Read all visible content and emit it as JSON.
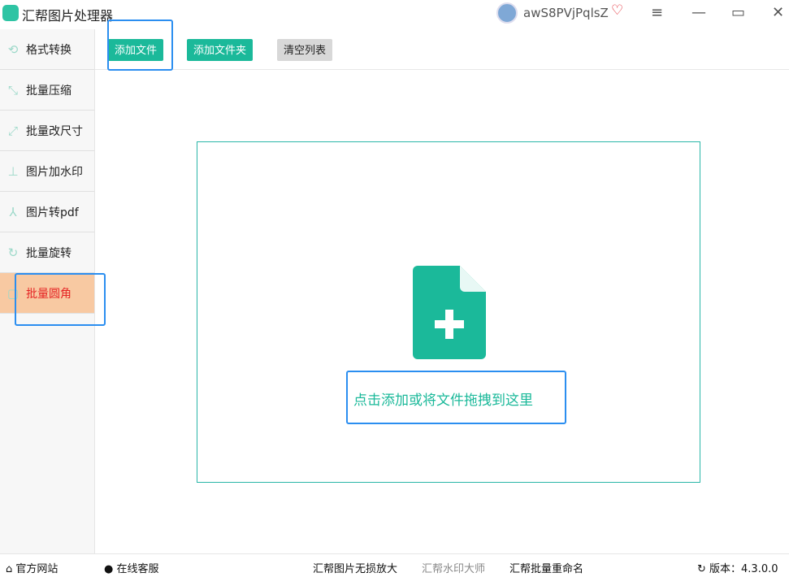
{
  "app": {
    "title": "汇帮图片处理器",
    "username": "awS8PVjPqlsZ"
  },
  "window": {
    "menu": "≡",
    "minimize": "—",
    "maximize": "▭",
    "close": "✕"
  },
  "sidebar": {
    "items": [
      {
        "label": "格式转换",
        "icon": "refresh-convert-icon"
      },
      {
        "label": "批量压缩",
        "icon": "compress-icon"
      },
      {
        "label": "批量改尺寸",
        "icon": "resize-icon"
      },
      {
        "label": "图片加水印",
        "icon": "stamp-icon"
      },
      {
        "label": "图片转pdf",
        "icon": "pdf-icon"
      },
      {
        "label": "批量旋转",
        "icon": "rotate-icon"
      },
      {
        "label": "批量圆角",
        "icon": "rounded-corner-icon",
        "active": true
      }
    ]
  },
  "toolbar": {
    "add_file": "添加文件",
    "add_folder": "添加文件夹",
    "clear_list": "清空列表"
  },
  "dropzone": {
    "text": "点击添加或将文件拖拽到这里"
  },
  "footer": {
    "website": "官方网站",
    "support": "在线客服",
    "link1": "汇帮图片无损放大",
    "link2": "汇帮水印大师",
    "link3": "汇帮批量重命名",
    "version": "版本：4.3.0.0"
  },
  "colors": {
    "accent": "#1bb99a",
    "active_bg": "#f8c9a2",
    "active_text": "#e52323",
    "highlight": "#2b8ef0"
  }
}
